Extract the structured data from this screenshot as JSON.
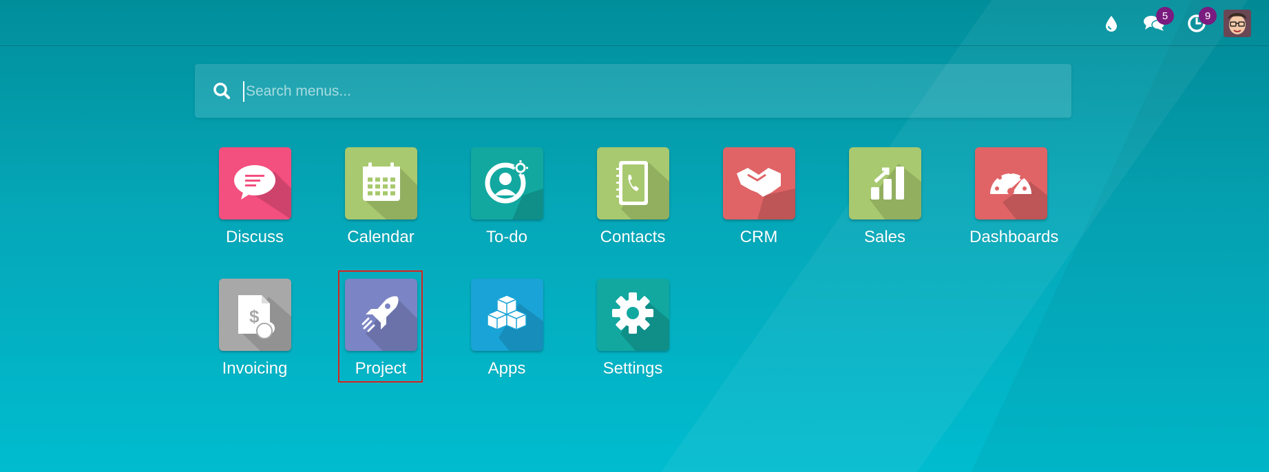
{
  "topbar": {
    "systray": [
      {
        "name": "debug-icon",
        "badge": ""
      },
      {
        "name": "messages-icon",
        "badge": "5"
      },
      {
        "name": "activity-icon",
        "badge": "9"
      }
    ]
  },
  "search": {
    "placeholder": "Search menus...",
    "value": ""
  },
  "apps": [
    {
      "label": "Discuss",
      "color": "#f34f7f"
    },
    {
      "label": "Calendar",
      "color": "#a8c96f"
    },
    {
      "label": "To-do",
      "color": "#12a8a0"
    },
    {
      "label": "Contacts",
      "color": "#a8c96f"
    },
    {
      "label": "CRM",
      "color": "#e06466"
    },
    {
      "label": "Sales",
      "color": "#a8c96f"
    },
    {
      "label": "Dashboards",
      "color": "#e06466"
    },
    {
      "label": "Invoicing",
      "color": "#a8a8a8"
    },
    {
      "label": "Project",
      "color": "#7b84c4"
    },
    {
      "label": "Apps",
      "color": "#1aa3d6"
    },
    {
      "label": "Settings",
      "color": "#12a8a0"
    }
  ],
  "highlight": {
    "target": "Project"
  }
}
